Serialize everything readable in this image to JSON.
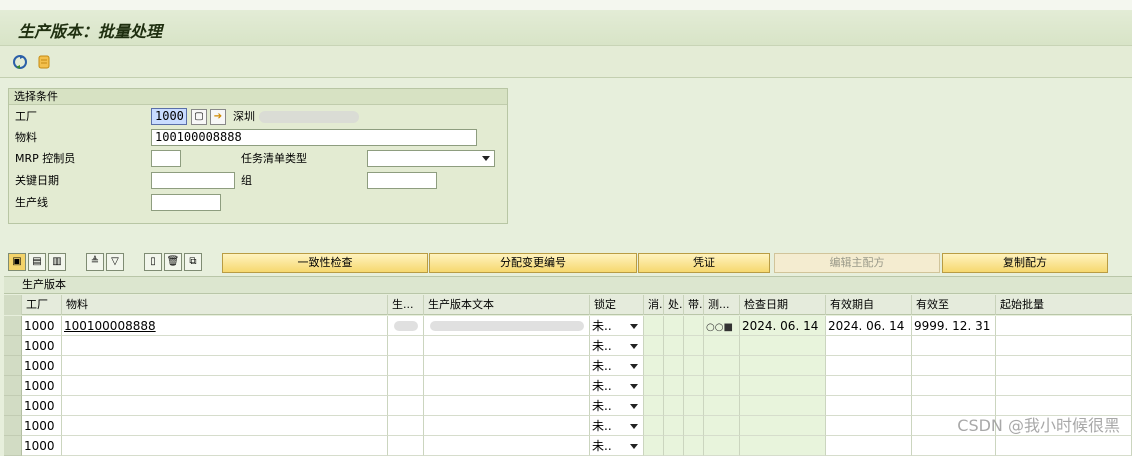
{
  "window": {
    "title": "生产版本：批量处理"
  },
  "toolbar": {
    "icons": [
      "refresh-icon",
      "scroll-icon"
    ]
  },
  "selection": {
    "header": "选择条件",
    "plant_label": "工厂",
    "plant_value": "1000",
    "plant_desc": "深圳",
    "material_label": "物料",
    "material_value": "100100008888",
    "mrp_label": "MRP 控制员",
    "mrp_value": "",
    "tasklist_label": "任务清单类型",
    "tasklist_value": "",
    "keydate_label": "关键日期",
    "keydate_value": "",
    "group_label": "组",
    "group_value": "",
    "line_label": "生产线",
    "line_value": ""
  },
  "grid_toolbar": {
    "buttons": [
      "一致性检查",
      "分配变更编号",
      "凭证",
      "编辑主配方",
      "复制配方"
    ]
  },
  "grid": {
    "title": "生产版本",
    "columns": [
      "工厂",
      "物料",
      "生...",
      "生产版本文本",
      "锁定",
      "消.",
      "处.",
      "带.",
      "测...",
      "检查日期",
      "有效期自",
      "有效至",
      "起始批量"
    ],
    "rows": [
      {
        "plant": "1000",
        "material": "100100008888",
        "lock": "未..",
        "status": "○○■",
        "check_date": "2024. 06. 14",
        "valid_from": "2024. 06. 14",
        "valid_to": "9999. 12. 31"
      },
      {
        "plant": "1000",
        "material": "",
        "lock": "未..",
        "status": "",
        "check_date": "",
        "valid_from": "",
        "valid_to": ""
      },
      {
        "plant": "1000",
        "material": "",
        "lock": "未..",
        "status": "",
        "check_date": "",
        "valid_from": "",
        "valid_to": ""
      },
      {
        "plant": "1000",
        "material": "",
        "lock": "未..",
        "status": "",
        "check_date": "",
        "valid_from": "",
        "valid_to": ""
      },
      {
        "plant": "1000",
        "material": "",
        "lock": "未..",
        "status": "",
        "check_date": "",
        "valid_from": "",
        "valid_to": ""
      },
      {
        "plant": "1000",
        "material": "",
        "lock": "未..",
        "status": "",
        "check_date": "",
        "valid_from": "",
        "valid_to": ""
      },
      {
        "plant": "1000",
        "material": "",
        "lock": "未..",
        "status": "",
        "check_date": "",
        "valid_from": "",
        "valid_to": ""
      }
    ]
  },
  "watermark": "CSDN @我小时候很黑"
}
